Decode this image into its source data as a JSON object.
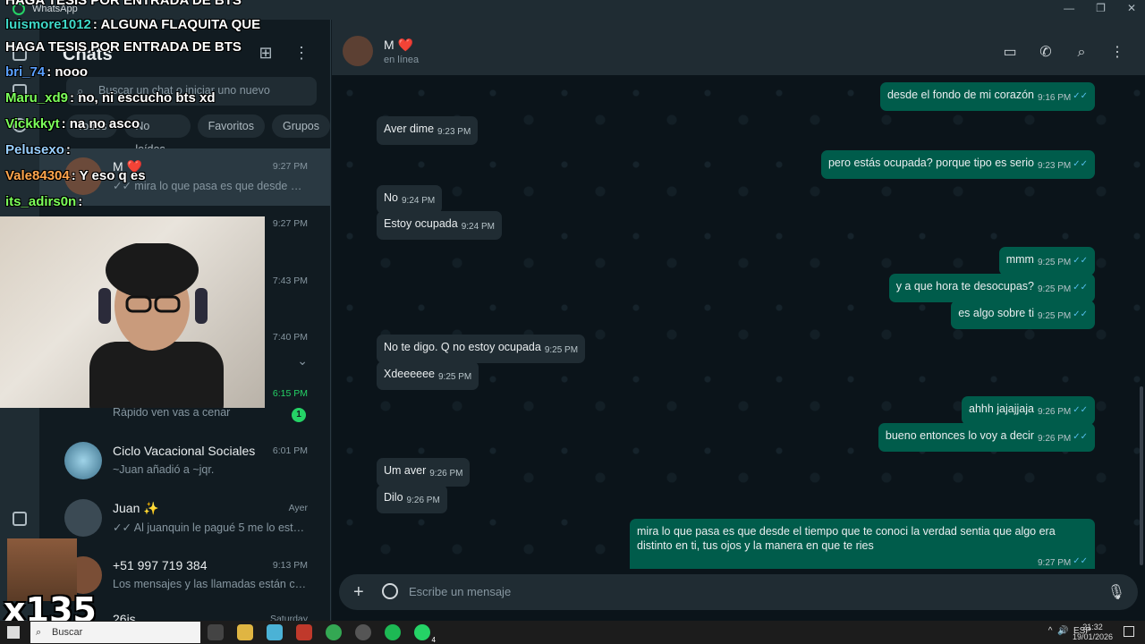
{
  "window": {
    "app_name": "WhatsApp",
    "minimize": "—",
    "restore": "❐",
    "close": "✕"
  },
  "sidebar": {
    "title": "Chats",
    "search_placeholder": "Buscar un chat o iniciar uno nuevo",
    "filters": [
      "Todos",
      "No leídos",
      "Favoritos",
      "Grupos"
    ],
    "chats": [
      {
        "name": "M ❤️",
        "time": "9:27 PM",
        "message": "✓✓ mira lo que pasa es que desde el tie..."
      },
      {
        "name": "",
        "time": "9:27 PM",
        "message": ""
      },
      {
        "name": "",
        "time": "7:43 PM",
        "message": ""
      },
      {
        "name": "",
        "time": "7:40 PM",
        "message": ""
      },
      {
        "name": "",
        "time": "6:15 PM",
        "message": "Rápido ven vas a cenar",
        "unread": "1"
      },
      {
        "name": "Ciclo Vacacional Sociales",
        "time": "6:01 PM",
        "message": "~Juan añadió a ~jqr."
      },
      {
        "name": "Juan ✨",
        "time": "Ayer",
        "message": "✓✓ Al juanquin le pagué 5 me lo está h..."
      },
      {
        "name": "+51 997 719 384",
        "time": "9:13 PM",
        "message": "Los mensajes y las llamadas están cifr..."
      },
      {
        "name": "26js",
        "time": "Saturday",
        "message": ""
      }
    ]
  },
  "conversation": {
    "contact_name": "M ❤️",
    "status": "en línea",
    "messages": [
      {
        "dir": "out",
        "text": "desde el fondo de mi corazón",
        "time": "9:16 PM"
      },
      {
        "dir": "in",
        "text": "Aver dime",
        "time": "9:23 PM"
      },
      {
        "dir": "out",
        "text": "pero estás ocupada? porque tipo es serio",
        "time": "9:23 PM"
      },
      {
        "dir": "in",
        "text": "No",
        "time": "9:24 PM"
      },
      {
        "dir": "in",
        "text": "Estoy ocupada",
        "time": "9:24 PM"
      },
      {
        "dir": "out",
        "text": "mmm",
        "time": "9:25 PM"
      },
      {
        "dir": "out",
        "text": "y a que hora te desocupas?",
        "time": "9:25 PM"
      },
      {
        "dir": "out",
        "text": "es algo sobre ti",
        "time": "9:25 PM"
      },
      {
        "dir": "in",
        "text": "No te digo. Q no estoy ocupada",
        "time": "9:25 PM"
      },
      {
        "dir": "in",
        "text": "Xdeeeeee",
        "time": "9:25 PM"
      },
      {
        "dir": "out",
        "text": "ahhh jajajjaja",
        "time": "9:26 PM"
      },
      {
        "dir": "out",
        "text": "bueno entonces lo voy a decir",
        "time": "9:26 PM"
      },
      {
        "dir": "in",
        "text": "Um aver",
        "time": "9:26 PM"
      },
      {
        "dir": "in",
        "text": "Dilo",
        "time": "9:26 PM"
      },
      {
        "dir": "out",
        "text": "mira lo que pasa es que desde el tiempo que te conoci la verdad sentia que algo era distinto en ti, tus ojos y la manera en que te ries",
        "time": "9:27 PM"
      }
    ],
    "composer_placeholder": "Escribe un mensaje",
    "ticks": "✓✓"
  },
  "stream_chat": [
    {
      "user": "",
      "text": "HAGA TESIS POR ENTRADA DE BTS",
      "color": "#ffffff"
    },
    {
      "user": "luismore1012",
      "text": ": ALGUNA FLAQUITA QUE",
      "color": "#3fd9c8"
    },
    {
      "user": "",
      "text": "HAGA TESIS POR ENTRADA DE BTS",
      "color": "#ffffff"
    },
    {
      "user": "bri_74",
      "text": ": nooo",
      "color": "#5aa0ff"
    },
    {
      "user": "Maru_xd9",
      "text": ": no, ni escucho bts xd",
      "color": "#7cff5a"
    },
    {
      "user": "Vickkkyt",
      "text": ": na no asco",
      "color": "#7cff5a"
    },
    {
      "user": "Pelusexo",
      "text": ":",
      "color": "#9ad0ff"
    },
    {
      "user": "Vale84304",
      "text": ": Y eso q es",
      "color": "#ffa64d"
    },
    {
      "user": "its_adirs0n",
      "text": ":",
      "color": "#7cff5a"
    }
  ],
  "combo": "x135",
  "taskbar": {
    "search_label": "Buscar",
    "tray_lang": "ESP",
    "time": "21:32",
    "date": "19/01/2026",
    "whatsapp_badge": "4"
  }
}
